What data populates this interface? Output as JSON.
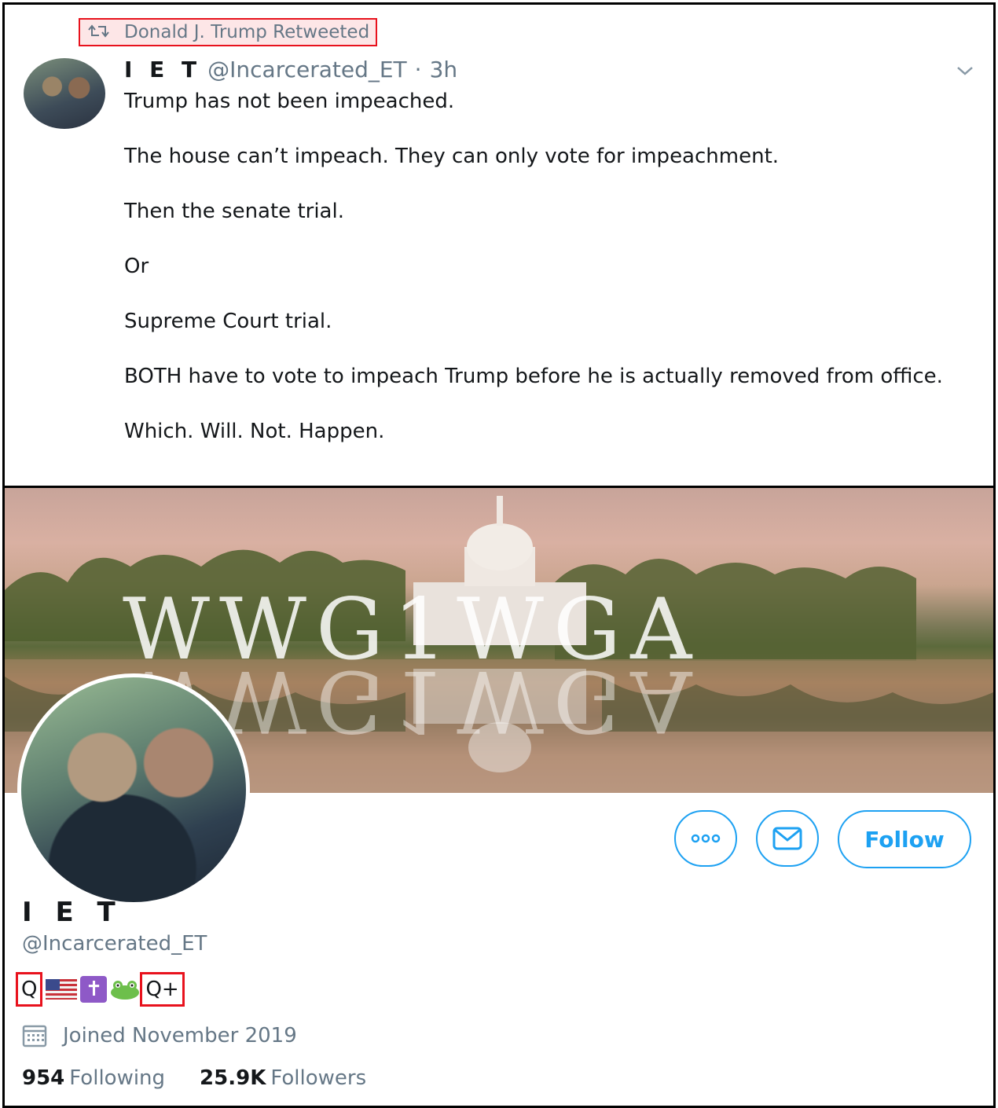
{
  "retweet_header": {
    "text": "Donald J. Trump Retweeted"
  },
  "tweet": {
    "author_name": "I E T",
    "author_handle": "@Incarcerated_ET",
    "separator": "·",
    "time": "3h",
    "paragraphs": [
      "Trump has not been impeached.",
      "The house can’t impeach. They can only vote for impeachment.",
      "Then the senate trial.",
      "Or",
      "Supreme Court trial.",
      "BOTH have to vote to impeach Trump before he is actually removed from office.",
      "Which. Will. Not. Happen."
    ]
  },
  "profile": {
    "banner_text": "WWG1WGA",
    "name": "I E T",
    "handle": "@Incarcerated_ET",
    "bio": {
      "q": "Q",
      "q_plus": "Q+",
      "cross": "✝"
    },
    "joined": "Joined November 2019",
    "following_count": "954",
    "following_label": "Following",
    "followers_count": "25.9K",
    "followers_label": "Followers",
    "follow_button": "Follow"
  },
  "colors": {
    "accent": "#1da1f2",
    "highlight_box": "#e8121d",
    "secondary_text": "#657786"
  }
}
